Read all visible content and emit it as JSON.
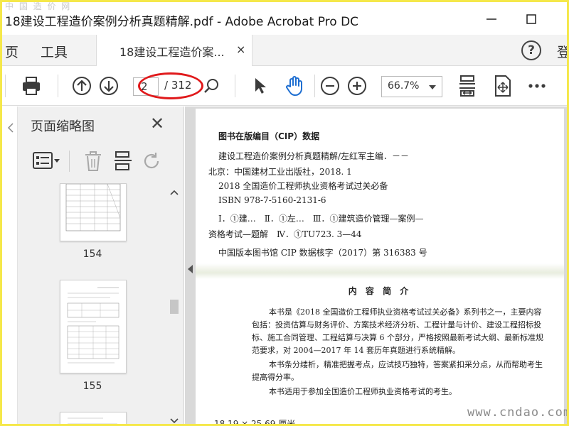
{
  "window": {
    "watermark_top": "中 国 造 价 网",
    "title": "18建设工程造价案例分析真题精解.pdf - Adobe Acrobat Pro DC",
    "minimize": "—",
    "maximize": "☐"
  },
  "menubar": {
    "home_label": "页",
    "tools_label": "工具",
    "tab_label": "18建设工程造价案...",
    "tab_close": "×",
    "help": "?",
    "login_label": "登"
  },
  "toolbar": {
    "current_page": "2",
    "total_pages": "/ 312",
    "zoom": "66.7%",
    "icons": [
      "print-icon",
      "prev-page-icon",
      "next-page-icon",
      "find-icon",
      "select-arrow-icon",
      "hand-tool-icon",
      "zoom-out-icon",
      "zoom-in-icon",
      "fit-page-icon",
      "scroll-mode-icon",
      "more-icon"
    ],
    "annotation_color": "#e0191b"
  },
  "panel": {
    "title": "页面缩略图",
    "close": "✕",
    "thumbnails": [
      {
        "label": "154"
      },
      {
        "label": "155"
      }
    ]
  },
  "document": {
    "cip_heading": "图书在版编目（CIP）数据",
    "cip_lines": [
      "建设工程造价案例分析真题精解/左红军主编．－－",
      "北京：中国建材工业出版社，2018. 1",
      "2018 全国造价工程师执业资格考试过关必备",
      "ISBN 978-7-5160-2131-6",
      "Ⅰ．①建…　Ⅱ．①左…　Ⅲ．①建筑造价管理—案例—",
      "资格考试—题解　Ⅳ．①TU723. 3—44",
      "中国版本图书馆 CIP 数据核字（2017）第 316383 号"
    ],
    "content_title": "内 容 简 介",
    "paragraphs": [
      "本书是《2018 全国造价工程师执业资格考试过关必备》系列书之一，主要内容包括：投资估算与财务评价、方案技术经济分析、工程计量与计价、建设工程招标投标、施工合同管理、工程结算与决算 6 个部分，严格按照最新考试大纲、最新标准规范要求，对 2004—2017 年 14 套历年真题进行系统精解。",
      "本书条分缕析，精准把握考点，应试技巧独特，答案紧扣采分点，从而帮助考生提高得分率。",
      "本书适用于参加全国造价工程师执业资格考试的考生。"
    ],
    "status_text": "18.19 × 25.69 厘米",
    "watermark_bottom": "www.cndao.com"
  }
}
